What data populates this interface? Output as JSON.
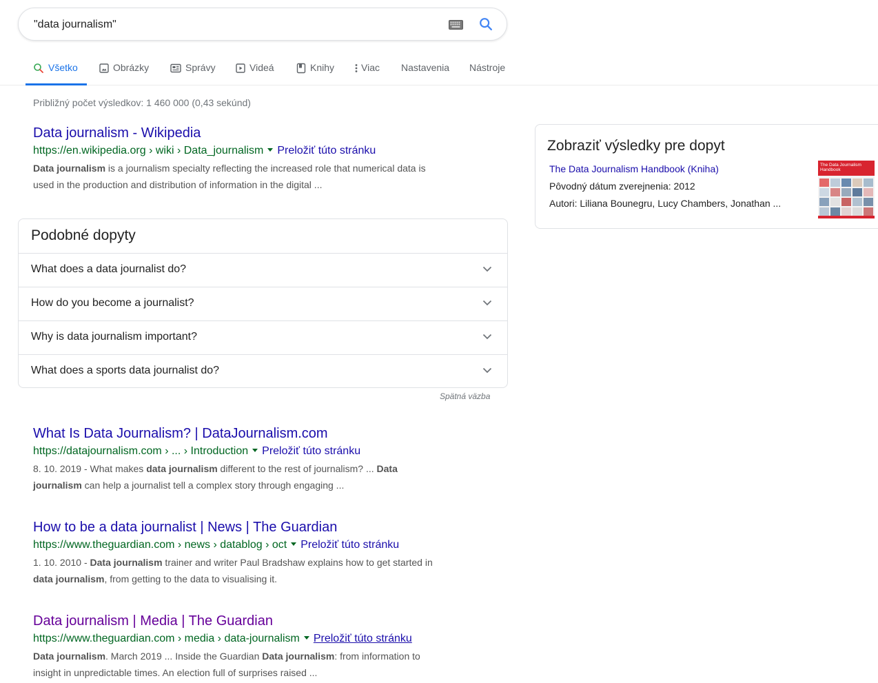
{
  "search": {
    "query": "\"data journalism\""
  },
  "tabs": [
    {
      "label": "Všetko",
      "icon": "search-icon"
    },
    {
      "label": "Obrázky",
      "icon": "image-icon"
    },
    {
      "label": "Správy",
      "icon": "news-icon"
    },
    {
      "label": "Videá",
      "icon": "video-icon"
    },
    {
      "label": "Knihy",
      "icon": "book-icon"
    },
    {
      "label": "Viac",
      "icon": "more-vert-icon"
    },
    {
      "label": "Nastavenia"
    },
    {
      "label": "Nástroje"
    }
  ],
  "stats": "Približný počet výsledkov: 1 460 000 (0,43 sekúnd)",
  "results": [
    {
      "title": "Data journalism - Wikipedia",
      "url": "https://en.wikipedia.org › wiki › Data_journalism",
      "translate": "Preložiť túto stránku",
      "snippet_line1_b": "Data journalism",
      "snippet_line1": " is a journalism specialty reflecting the increased role that numerical data is",
      "snippet_line2": "used in the production and distribution of information in the digital ..."
    },
    {
      "title": "What Is Data Journalism? | DataJournalism.com",
      "url": "https://datajournalism.com › ... › Introduction",
      "translate": "Preložiť túto stránku",
      "snippet_line1_a": "8. 10. 2019 - What makes ",
      "snippet_line1_b": "data journalism",
      "snippet_line1_c": " different to the rest of journalism? ... ",
      "snippet_line1_d": "Data",
      "snippet_line2_b": "journalism",
      "snippet_line2": " can help a journalist tell a complex story through engaging ..."
    },
    {
      "title": "How to be a data journalist | News | The Guardian",
      "url": "https://www.theguardian.com › news › datablog › oct",
      "translate": "Preložiť túto stránku",
      "snippet_line1_a": "1. 10. 2010 - ",
      "snippet_line1_b": "Data journalism",
      "snippet_line1_c": " trainer and writer Paul Bradshaw explains how to get started in",
      "snippet_line2_b": "data journalism",
      "snippet_line2": ", from getting to the data to visualising it."
    },
    {
      "title": "Data journalism | Media | The Guardian",
      "url": "https://www.theguardian.com › media › data-journalism",
      "translate": "Preložiť túto stránku",
      "snippet_line1_b": "Data journalism",
      "snippet_line1_c": ". March 2019 ... Inside the Guardian ",
      "snippet_line1_d": "Data journalism",
      "snippet_line1_e": ": from information to",
      "snippet_line2": "insight in unpredictable times. An election full of surprises raised ..."
    }
  ],
  "related": {
    "title": "Podobné dopyty",
    "questions": [
      "What does a data journalist do?",
      "How do you become a journalist?",
      "Why is data journalism important?",
      "What does a sports data journalist do?"
    ],
    "feedback": "Spätná väzba"
  },
  "knowledge_panel": {
    "title": "Zobraziť výsledky pre dopyt",
    "link": "The Data Journalism Handbook (Kniha)",
    "published": "Pôvodný dátum zverejnenia: 2012",
    "authors": "Autori: Liliana Bounegru, Lucy Chambers, Jonathan ...",
    "thumb_text": "The Data Journalism Handbook"
  },
  "colors": {
    "link": "#1a0dab",
    "visited": "#660099",
    "url_green": "#006621",
    "tab_active": "#1a73e8",
    "book_red": "#d8242f"
  }
}
